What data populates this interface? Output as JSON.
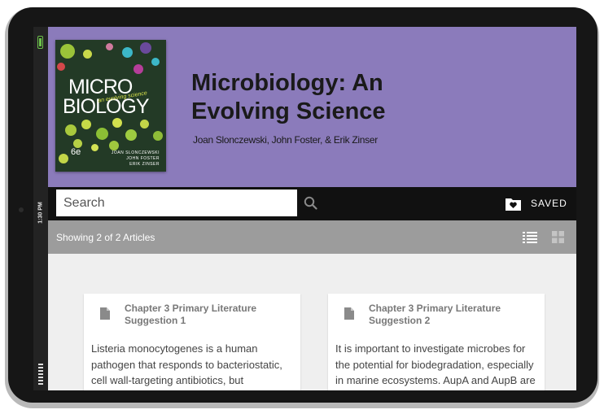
{
  "device": {
    "clock": "1:30 PM"
  },
  "book": {
    "title": "Microbiology: An Evolving Science",
    "authors": "Joan Slonczewski, John Foster, & Erik Zinser",
    "cover": {
      "title_line1": "MICRO",
      "title_line2": "BIOLOGY",
      "subtitle": "an evolving science",
      "edition": "6e",
      "authors": [
        "JOAN SLONCZEWSKI",
        "JOHN FOSTER",
        "ERIK ZINSER"
      ]
    }
  },
  "toolbar": {
    "search_placeholder": "Search",
    "saved_label": "SAVED"
  },
  "results": {
    "summary": "Showing 2 of 2 Articles"
  },
  "articles": [
    {
      "title": "Chapter 3 Primary Literature Suggestion 1",
      "excerpt": "Listeria monocytogenes is a human pathogen that responds to bacteriostatic, cell wall-targeting antibiotics, but"
    },
    {
      "title": "Chapter 3 Primary Literature Suggestion 2",
      "excerpt": "It is important to investigate microbes for the potential for biodegradation, especially in marine ecosystems. AupA and AupB are"
    }
  ],
  "colors": {
    "banner": "#8b7bbb",
    "toolbar": "#111111",
    "info_bar": "#9c9c9c",
    "battery": "#6cc24a"
  },
  "icons": [
    "battery-icon",
    "search-icon",
    "saved-folder-icon",
    "list-view-icon",
    "grid-view-icon",
    "document-icon"
  ]
}
